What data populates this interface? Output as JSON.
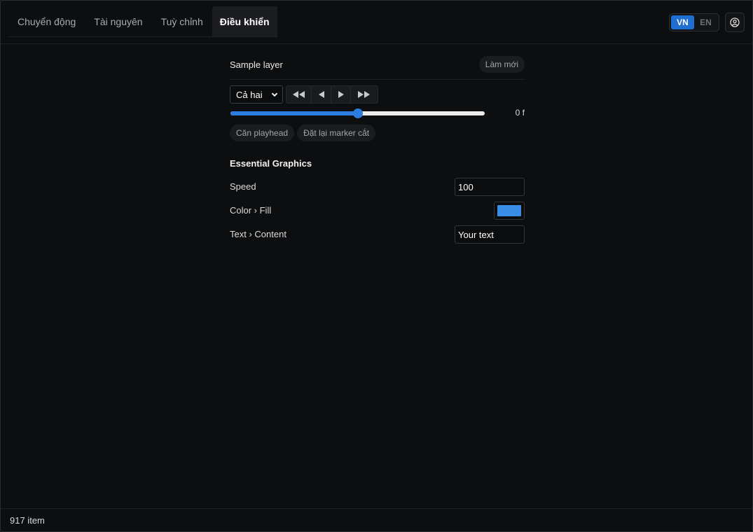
{
  "tabs": [
    {
      "label": "Chuyển động",
      "active": false
    },
    {
      "label": "Tài nguyên",
      "active": false
    },
    {
      "label": "Tuỳ chỉnh",
      "active": false
    },
    {
      "label": "Điều khiển",
      "active": true
    }
  ],
  "language": {
    "options": [
      "VN",
      "EN"
    ],
    "selected": "VN"
  },
  "user": {
    "icon": "user-circle-icon"
  },
  "layer": {
    "title": "Sample layer",
    "refresh_label": "Làm mới"
  },
  "playback": {
    "mode_select": {
      "value": "Cả hai",
      "icon": "chevron-down-icon"
    },
    "transport_icons": [
      "fast-backward-icon",
      "step-back-icon",
      "play-icon",
      "fast-forward-icon"
    ],
    "scrub_progress": 0.5,
    "frame_readout": "0 f",
    "align_playhead_label": "Căn playhead",
    "reset_markers_label": "Đặt lại marker cắt"
  },
  "essential_graphics": {
    "title": "Essential Graphics",
    "speed": {
      "label": "Speed",
      "value": "100"
    },
    "color_fill": {
      "label": "Color › Fill",
      "value": "#3b8ee8"
    },
    "text_content": {
      "label": "Text › Content",
      "value": "Your text"
    }
  },
  "status": {
    "text": "917 item"
  },
  "colors": {
    "accent": "#2b7de0",
    "background": "#0d0e10"
  }
}
